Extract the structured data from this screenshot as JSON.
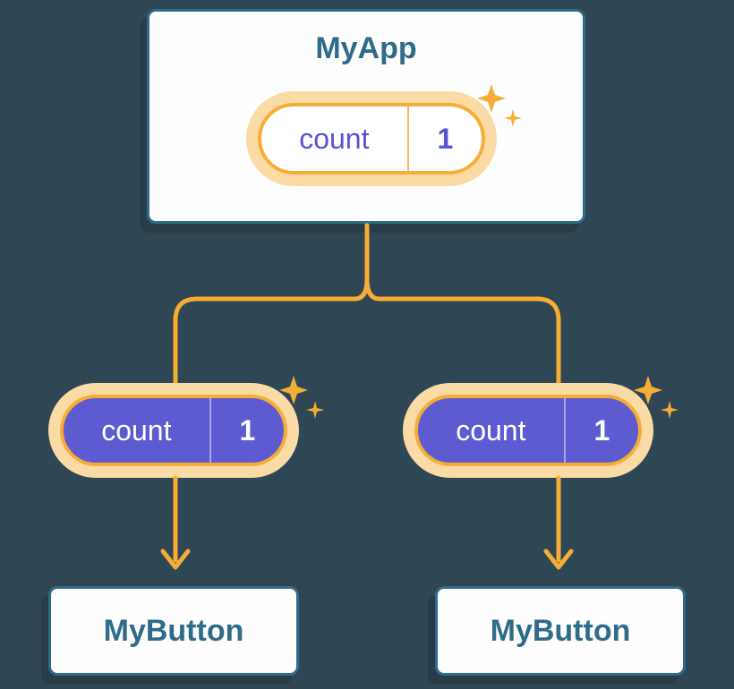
{
  "parent": {
    "name": "MyApp",
    "state": {
      "label": "count",
      "value": "1"
    }
  },
  "propLeft": {
    "label": "count",
    "value": "1"
  },
  "propRight": {
    "label": "count",
    "value": "1"
  },
  "children": {
    "left": {
      "name": "MyButton"
    },
    "right": {
      "name": "MyButton"
    }
  },
  "colors": {
    "orange": "#f6ad36",
    "orangeLight": "#fbdba5",
    "purple": "#5e5bd1",
    "teal": "#2f6c8a"
  }
}
